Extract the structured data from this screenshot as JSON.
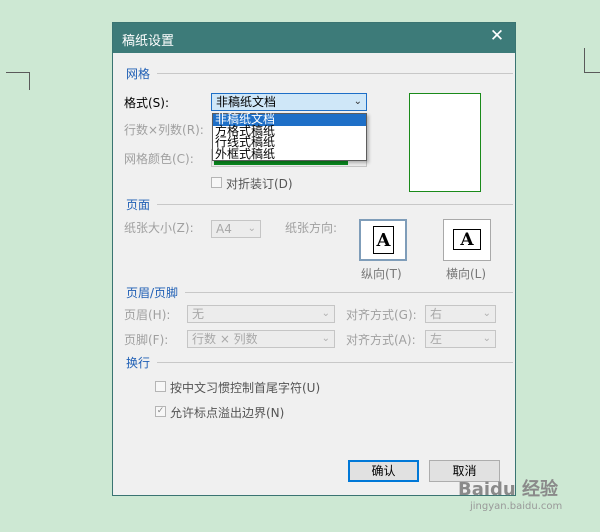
{
  "dialog": {
    "title": "稿纸设置",
    "close_icon": "close-icon",
    "ok_label": "确认",
    "cancel_label": "取消"
  },
  "grid_section": {
    "header": "网格",
    "format_label": "格式(S):",
    "format_value": "非稿纸文档",
    "format_options": [
      "非稿纸文档",
      "方格式稿纸",
      "行线式稿纸",
      "外框式稿纸"
    ],
    "rows_cols_label": "行数×列数(R):",
    "grid_color_label": "网格颜色(C):",
    "fold_label": "对折装订(D)"
  },
  "page_section": {
    "header": "页面",
    "paper_size_label": "纸张大小(Z):",
    "paper_size_value": "A4",
    "orientation_label": "纸张方向:",
    "portrait_label": "纵向(T)",
    "landscape_label": "横向(L)",
    "portrait_glyph": "A",
    "landscape_glyph": "A"
  },
  "header_footer_section": {
    "header": "页眉/页脚",
    "header_label": "页眉(H):",
    "header_value": "无",
    "header_align_label": "对齐方式(G):",
    "header_align_value": "右",
    "footer_label": "页脚(F):",
    "footer_value": "行数 × 列数",
    "footer_align_label": "对齐方式(A):",
    "footer_align_value": "左"
  },
  "line_break_section": {
    "header": "换行",
    "option1_label": "按中文习惯控制首尾字符(U)",
    "option2_label": "允许标点溢出边界(N)"
  },
  "watermark": {
    "text": "Baidu 经验",
    "url": "jingyan.baidu.com"
  },
  "colors": {
    "titlebar": "#3d7b79",
    "section_header": "#1f5fb5",
    "grid_color_swatch": "#0a8a1f",
    "background": "#cde8d3"
  }
}
